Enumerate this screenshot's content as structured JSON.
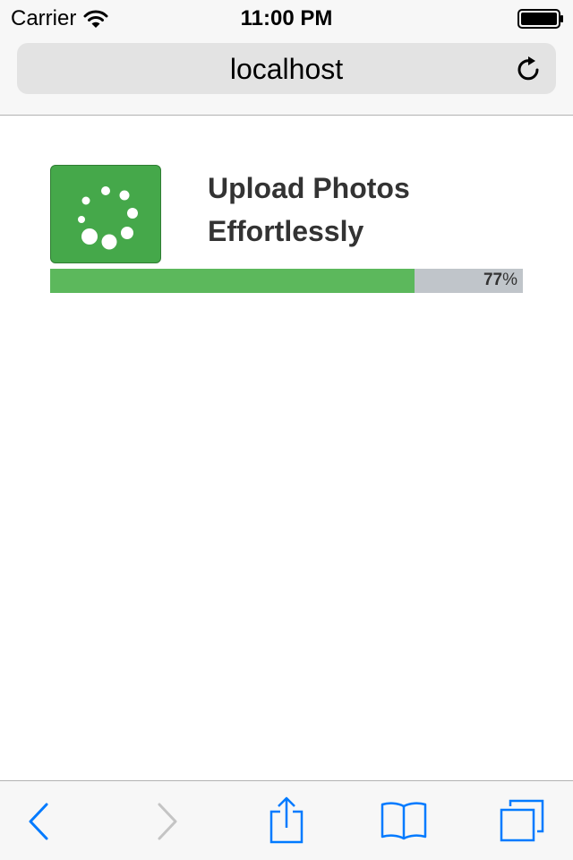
{
  "status_bar": {
    "carrier": "Carrier",
    "time": "11:00 PM",
    "icons": [
      "wifi-icon",
      "battery-icon"
    ]
  },
  "address_bar": {
    "url": "localhost",
    "reload_icon": "reload-icon"
  },
  "upload": {
    "title": "Upload Photos Effortlessly",
    "icon": "spinner-icon",
    "progress": {
      "value": 77,
      "unit": "%"
    }
  },
  "toolbar": {
    "items": [
      "back-icon",
      "forward-icon",
      "share-icon",
      "bookmarks-icon",
      "tabs-icon"
    ]
  },
  "colors": {
    "accent": "#007aff",
    "progress_fill": "#5cb85c",
    "progress_track": "#c0c5ca",
    "icon_box": "#45a84a"
  }
}
